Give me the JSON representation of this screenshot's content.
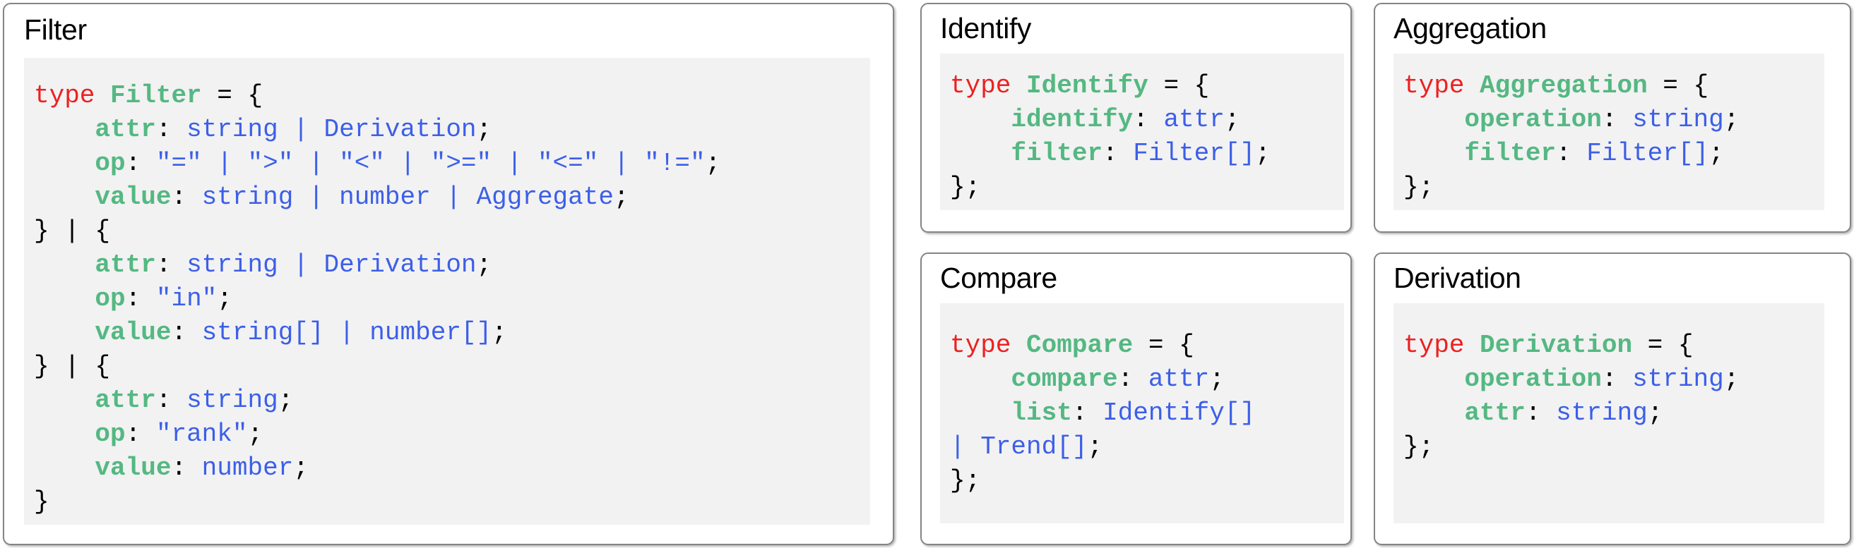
{
  "theme": {
    "panel_border": "#858585",
    "panel_background": "#ffffff",
    "code_background": "#f2f2f2",
    "keyword_color": "#ee2020",
    "identifier_color": "#54b882",
    "type_color": "#3c5fe8",
    "punctuation_color": "#000000"
  },
  "panels": {
    "filter": {
      "title": "Filter",
      "code_lines": [
        [
          {
            "t": "type ",
            "c": "kw"
          },
          {
            "t": "Filter",
            "c": "name"
          },
          {
            "t": " = {",
            "c": "pun"
          }
        ],
        [
          {
            "t": "    ",
            "c": "pun"
          },
          {
            "t": "attr",
            "c": "prop"
          },
          {
            "t": ": ",
            "c": "pun"
          },
          {
            "t": "string | Derivation",
            "c": "type"
          },
          {
            "t": ";",
            "c": "pun"
          }
        ],
        [
          {
            "t": "    ",
            "c": "pun"
          },
          {
            "t": "op",
            "c": "prop"
          },
          {
            "t": ": ",
            "c": "pun"
          },
          {
            "t": "\"=\" | \">\" | \"<\" | \">=\" | \"<=\" | \"!=\"",
            "c": "str"
          },
          {
            "t": ";",
            "c": "pun"
          }
        ],
        [
          {
            "t": "    ",
            "c": "pun"
          },
          {
            "t": "value",
            "c": "prop"
          },
          {
            "t": ": ",
            "c": "pun"
          },
          {
            "t": "string | number | Aggregate",
            "c": "type"
          },
          {
            "t": ";",
            "c": "pun"
          }
        ],
        [
          {
            "t": "} | {",
            "c": "pun"
          }
        ],
        [
          {
            "t": "    ",
            "c": "pun"
          },
          {
            "t": "attr",
            "c": "prop"
          },
          {
            "t": ": ",
            "c": "pun"
          },
          {
            "t": "string | Derivation",
            "c": "type"
          },
          {
            "t": ";",
            "c": "pun"
          }
        ],
        [
          {
            "t": "    ",
            "c": "pun"
          },
          {
            "t": "op",
            "c": "prop"
          },
          {
            "t": ": ",
            "c": "pun"
          },
          {
            "t": "\"in\"",
            "c": "str"
          },
          {
            "t": ";",
            "c": "pun"
          }
        ],
        [
          {
            "t": "    ",
            "c": "pun"
          },
          {
            "t": "value",
            "c": "prop"
          },
          {
            "t": ": ",
            "c": "pun"
          },
          {
            "t": "string[] | number[]",
            "c": "type"
          },
          {
            "t": ";",
            "c": "pun"
          }
        ],
        [
          {
            "t": "} | {",
            "c": "pun"
          }
        ],
        [
          {
            "t": "    ",
            "c": "pun"
          },
          {
            "t": "attr",
            "c": "prop"
          },
          {
            "t": ": ",
            "c": "pun"
          },
          {
            "t": "string",
            "c": "type"
          },
          {
            "t": ";",
            "c": "pun"
          }
        ],
        [
          {
            "t": "    ",
            "c": "pun"
          },
          {
            "t": "op",
            "c": "prop"
          },
          {
            "t": ": ",
            "c": "pun"
          },
          {
            "t": "\"rank\"",
            "c": "str"
          },
          {
            "t": ";",
            "c": "pun"
          }
        ],
        [
          {
            "t": "    ",
            "c": "pun"
          },
          {
            "t": "value",
            "c": "prop"
          },
          {
            "t": ": ",
            "c": "pun"
          },
          {
            "t": "number",
            "c": "type"
          },
          {
            "t": ";",
            "c": "pun"
          }
        ],
        [
          {
            "t": "}",
            "c": "pun"
          }
        ]
      ]
    },
    "identify": {
      "title": "Identify",
      "code_lines": [
        [
          {
            "t": "type ",
            "c": "kw"
          },
          {
            "t": "Identify",
            "c": "name"
          },
          {
            "t": " = {",
            "c": "pun"
          }
        ],
        [
          {
            "t": "    ",
            "c": "pun"
          },
          {
            "t": "identify",
            "c": "prop"
          },
          {
            "t": ": ",
            "c": "pun"
          },
          {
            "t": "attr",
            "c": "type"
          },
          {
            "t": ";",
            "c": "pun"
          }
        ],
        [
          {
            "t": "    ",
            "c": "pun"
          },
          {
            "t": "filter",
            "c": "prop"
          },
          {
            "t": ": ",
            "c": "pun"
          },
          {
            "t": "Filter[]",
            "c": "type"
          },
          {
            "t": ";",
            "c": "pun"
          }
        ],
        [
          {
            "t": "};",
            "c": "pun"
          }
        ]
      ]
    },
    "aggregation": {
      "title": "Aggregation",
      "code_lines": [
        [
          {
            "t": "type ",
            "c": "kw"
          },
          {
            "t": "Aggregation",
            "c": "name"
          },
          {
            "t": " = {",
            "c": "pun"
          }
        ],
        [
          {
            "t": "    ",
            "c": "pun"
          },
          {
            "t": "operation",
            "c": "prop"
          },
          {
            "t": ": ",
            "c": "pun"
          },
          {
            "t": "string",
            "c": "type"
          },
          {
            "t": ";",
            "c": "pun"
          }
        ],
        [
          {
            "t": "    ",
            "c": "pun"
          },
          {
            "t": "filter",
            "c": "prop"
          },
          {
            "t": ": ",
            "c": "pun"
          },
          {
            "t": "Filter[]",
            "c": "type"
          },
          {
            "t": ";",
            "c": "pun"
          }
        ],
        [
          {
            "t": "};",
            "c": "pun"
          }
        ]
      ]
    },
    "compare": {
      "title": "Compare",
      "code_lines": [
        [
          {
            "t": "type ",
            "c": "kw"
          },
          {
            "t": "Compare",
            "c": "name"
          },
          {
            "t": " = {",
            "c": "pun"
          }
        ],
        [
          {
            "t": "    ",
            "c": "pun"
          },
          {
            "t": "compare",
            "c": "prop"
          },
          {
            "t": ": ",
            "c": "pun"
          },
          {
            "t": "attr",
            "c": "type"
          },
          {
            "t": ";",
            "c": "pun"
          }
        ],
        [
          {
            "t": "    ",
            "c": "pun"
          },
          {
            "t": "list",
            "c": "prop"
          },
          {
            "t": ": ",
            "c": "pun"
          },
          {
            "t": "Identify[]",
            "c": "type"
          }
        ],
        [
          {
            "t": "| Trend[]",
            "c": "type"
          },
          {
            "t": ";",
            "c": "pun"
          }
        ],
        [
          {
            "t": "};",
            "c": "pun"
          }
        ]
      ]
    },
    "derivation": {
      "title": "Derivation",
      "code_lines": [
        [
          {
            "t": "type ",
            "c": "kw"
          },
          {
            "t": "Derivation",
            "c": "name"
          },
          {
            "t": " = {",
            "c": "pun"
          }
        ],
        [
          {
            "t": "    ",
            "c": "pun"
          },
          {
            "t": "operation",
            "c": "prop"
          },
          {
            "t": ": ",
            "c": "pun"
          },
          {
            "t": "string",
            "c": "type"
          },
          {
            "t": ";",
            "c": "pun"
          }
        ],
        [
          {
            "t": "    ",
            "c": "pun"
          },
          {
            "t": "attr",
            "c": "prop"
          },
          {
            "t": ": ",
            "c": "pun"
          },
          {
            "t": "string",
            "c": "type"
          },
          {
            "t": ";",
            "c": "pun"
          }
        ],
        [
          {
            "t": "};",
            "c": "pun"
          }
        ]
      ]
    }
  }
}
